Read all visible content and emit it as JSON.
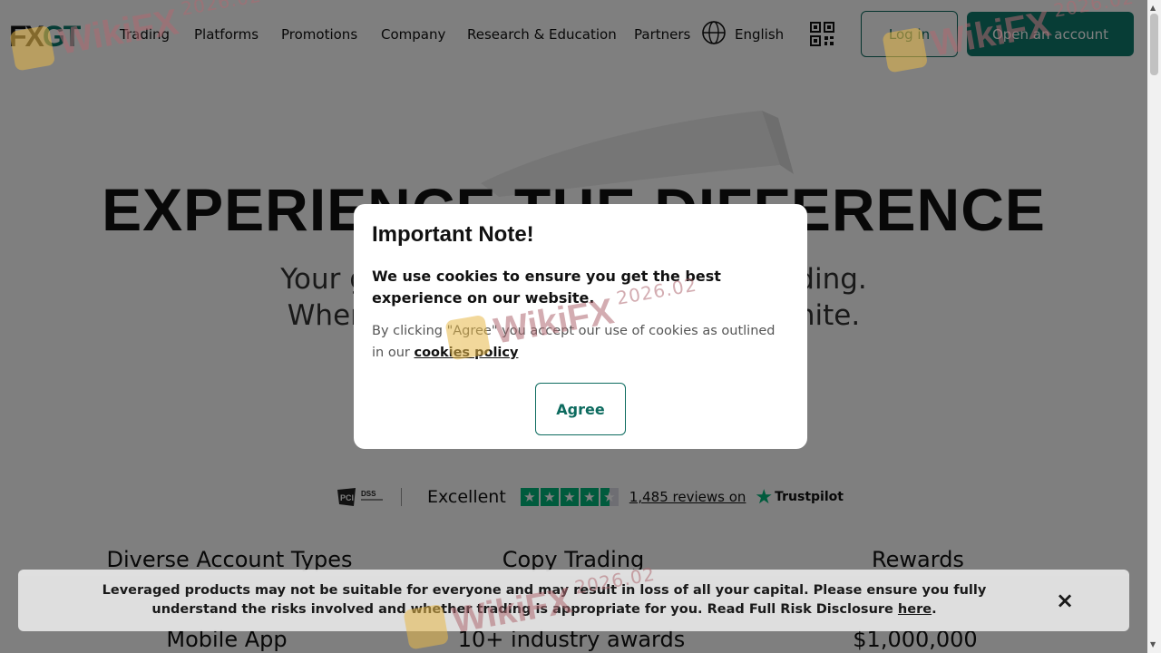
{
  "header": {
    "logo_fx": "FX",
    "logo_gt": "GT",
    "nav": [
      "Trading",
      "Platforms",
      "Promotions",
      "Company",
      "Research & Education",
      "Partners"
    ],
    "language": "English",
    "login_label": "Log in",
    "open_account_label": "Open an account"
  },
  "hero": {
    "title": "EXPERIENCE THE DIFFERENCE",
    "sub_line1": "Your gateway to advanced online trading.",
    "sub_line2": "Where innovation and opportunity unite."
  },
  "trust": {
    "rating_word": "Excellent",
    "reviews_text": "1,485 reviews on",
    "brand": "Trustpilot",
    "stars": 4.5
  },
  "features": {
    "row1": [
      "Diverse Account Types",
      "Copy Trading",
      "Rewards"
    ],
    "row2": [
      "Mobile App",
      "10+ industry awards",
      "$1,000,000"
    ]
  },
  "modal": {
    "title": "Important Note!",
    "main_text": "We use cookies to ensure you get the best experience on our website.",
    "small_text": "By clicking \"Agree\" you accept our use of cookies as outlined in our ",
    "link_text": "cookies policy",
    "agree_label": "Agree"
  },
  "risk": {
    "text": "Leveraged products may not be suitable for everyone and may result in loss of all your capital. Please ensure you fully understand the risks involved and whether trading is appropriate for you. Read Full Risk Disclosure ",
    "link_text": "here",
    "link_suffix": ".",
    "close_icon": "×"
  },
  "watermark": {
    "text": "WikiFX",
    "date": "2026.02"
  },
  "colors": {
    "brand": "#0f7a6c",
    "trustpilot": "#00b67a"
  }
}
